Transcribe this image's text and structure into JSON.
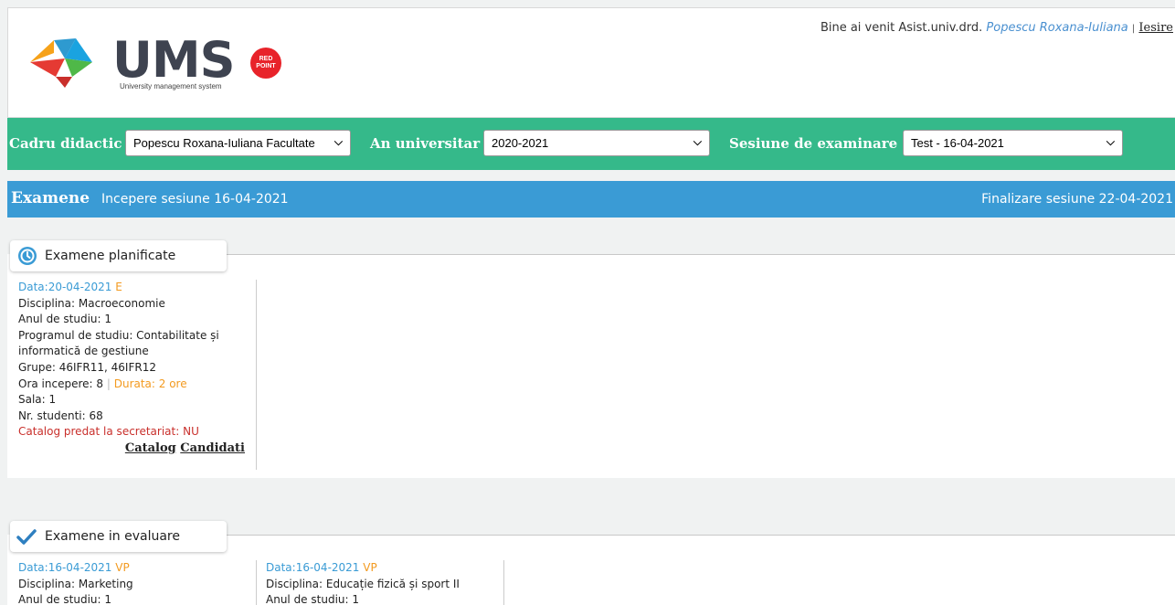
{
  "header": {
    "logo_text": "UMS",
    "logo_subtitle": "University management system",
    "redpoint_badge": "RED POINT",
    "welcome_prefix": "Bine ai venit Asist.univ.drd.",
    "user_name": "Popescu Roxana-Iuliana",
    "separator": "|",
    "logout_label": "Iesire"
  },
  "filters": {
    "teacher_label": "Cadru didactic",
    "teacher_value": "Popescu Roxana-Iuliana Facultate",
    "year_label": "An universitar",
    "year_value": "2020-2021",
    "session_label": "Sesiune de examinare",
    "session_value": "Test - 16-04-2021"
  },
  "exams_bar": {
    "title": "Examene",
    "start": "Incepere sesiune 16-04-2021",
    "end": "Finalizare sesiune 22-04-2021"
  },
  "planned": {
    "title": "Examene planificate",
    "cards": [
      {
        "date": "Data:20-04-2021",
        "type": "E",
        "discipline": "Disciplina: Macroeconomie",
        "year": "Anul de studiu: 1",
        "program_line1": "Programul de studiu: Contabilitate și",
        "program_line2": "informatică de gestiune",
        "groups": "Grupe: 46IFR11, 46IFR12",
        "start_hour": "Ora incepere: 8",
        "duration": "Durata: 2 ore",
        "room": "Sala: 1",
        "students": "Nr. studenti: 68",
        "catalog_status": "Catalog predat la secretariat: NU",
        "link_catalog": "Catalog",
        "link_candidates": "Candidati"
      }
    ]
  },
  "evaluation": {
    "title": "Examene in evaluare",
    "cards": [
      {
        "date": "Data:16-04-2021",
        "type": "VP",
        "discipline": "Disciplina: Marketing",
        "year": "Anul de studiu: 1"
      },
      {
        "date": "Data:16-04-2021",
        "type": "VP",
        "discipline": "Disciplina: Educație fizică și sport II",
        "year": "Anul de studiu: 1"
      }
    ]
  },
  "colors": {
    "green_bar": "#35b98a",
    "blue_bar": "#3a9bd5",
    "accent_orange": "#f39a1f",
    "alert_red": "#c9302c"
  },
  "icons": {
    "planned": "clock-icon",
    "evaluation": "checkmark-icon",
    "dropdown": "chevron-down-icon"
  }
}
